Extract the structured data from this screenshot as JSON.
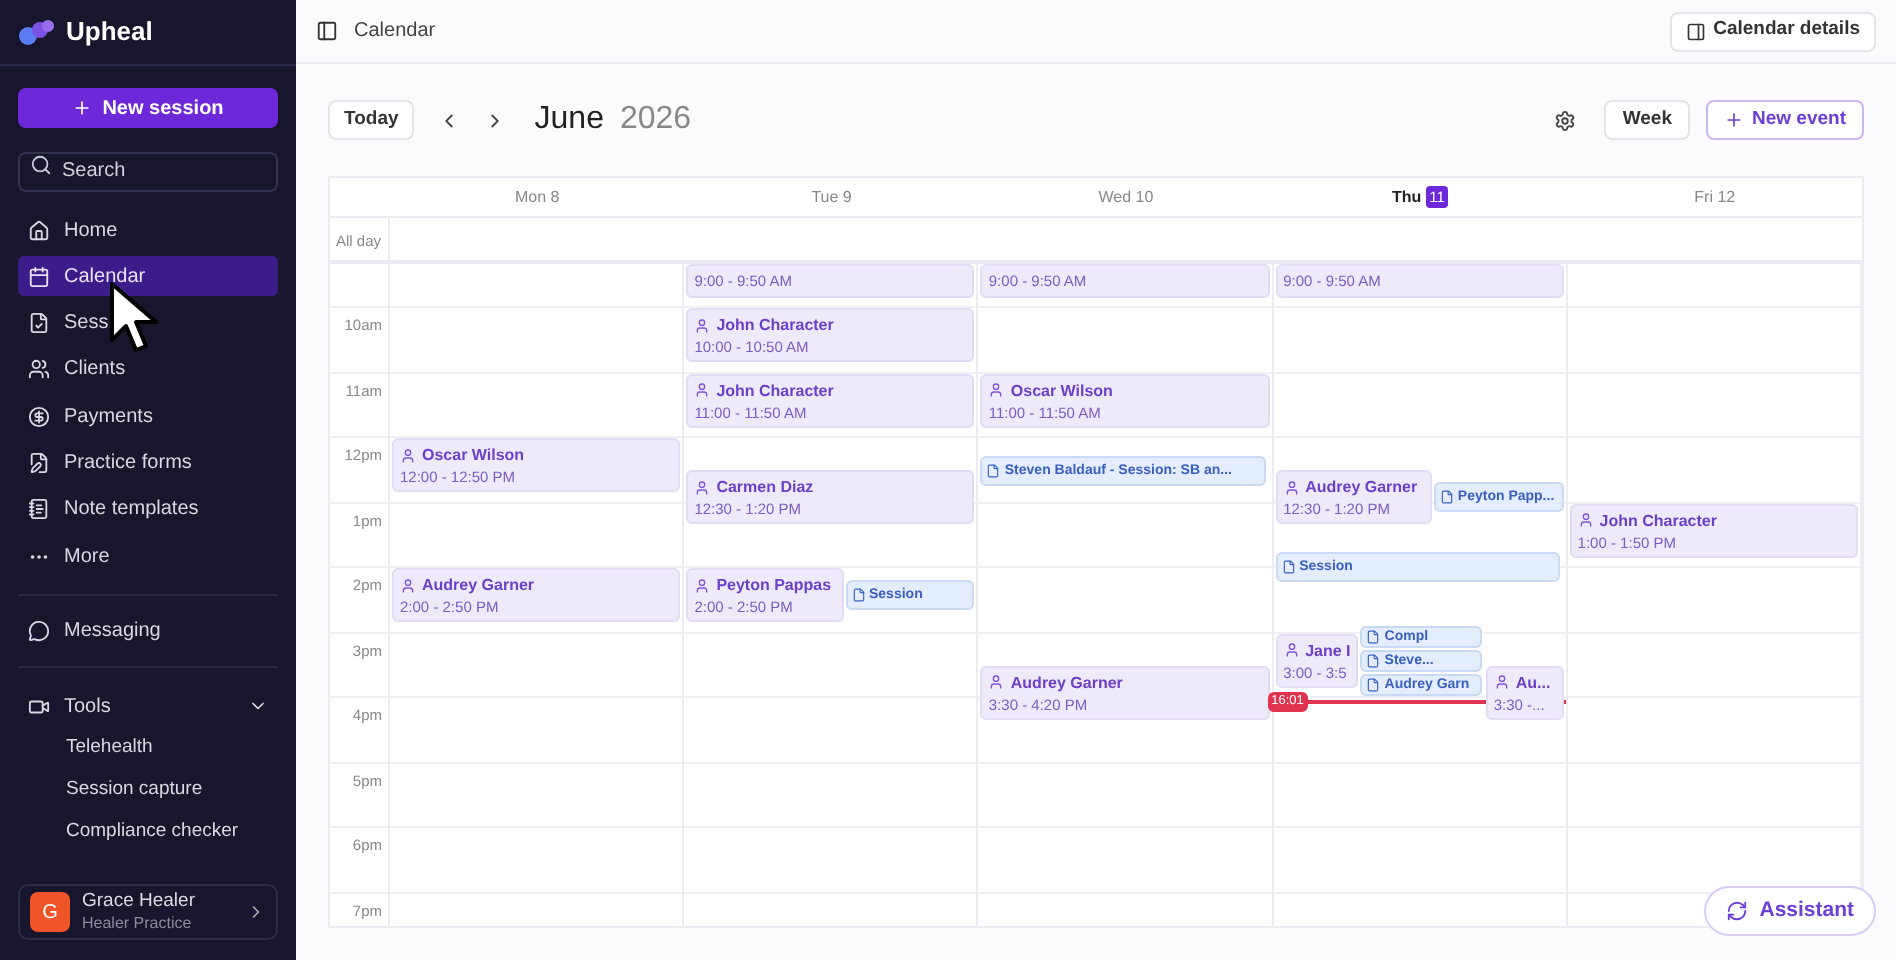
{
  "brand": {
    "name": "Upheal"
  },
  "sidebar": {
    "new_button": "New session",
    "search": {
      "placeholder": "Search"
    },
    "items": [
      {
        "label": "Home",
        "selected": false
      },
      {
        "label": "Calendar",
        "selected": true
      },
      {
        "label": "Sess",
        "selected": false
      },
      {
        "label": "Clients",
        "selected": false
      },
      {
        "label": "Payments",
        "selected": false
      },
      {
        "label": "Practice forms",
        "selected": false
      },
      {
        "label": "Note templates",
        "selected": false
      },
      {
        "label": "More",
        "selected": false
      }
    ],
    "messaging": "Messaging",
    "tools": {
      "label": "Tools",
      "expanded": true,
      "children": [
        "Telehealth",
        "Session capture",
        "Compliance checker"
      ]
    },
    "user": {
      "initial": "G",
      "name": "Grace Healer",
      "practice": "Healer Practice"
    }
  },
  "topbar": {
    "title": "Calendar",
    "details_button": "Calendar details"
  },
  "toolbar": {
    "today": "Today",
    "month": "June",
    "year": "2026",
    "view": "Week",
    "new_event": "New event"
  },
  "calendar": {
    "all_day": "All day",
    "hours": [
      "10am",
      "11am",
      "12pm",
      "1pm",
      "2pm",
      "3pm",
      "4pm",
      "5pm",
      "6pm",
      "7pm"
    ],
    "days": [
      {
        "label": "Mon 8",
        "today": false,
        "events": [
          {
            "kind": "client",
            "name": "Oscar Wilson",
            "time": "12:00 - 12:50 PM"
          },
          {
            "kind": "client",
            "name": "Audrey Garner",
            "time": "2:00 - 2:50 PM"
          }
        ]
      },
      {
        "label": "Tue 9",
        "today": false,
        "events": [
          {
            "kind": "client",
            "time": "9:00 - 9:50 AM"
          },
          {
            "kind": "client",
            "name": "John Character",
            "time": "10:00 - 10:50 AM"
          },
          {
            "kind": "client",
            "name": "John Character",
            "time": "11:00 - 11:50 AM"
          },
          {
            "kind": "client",
            "name": "Carmen Diaz",
            "time": "12:30 - 1:20 PM"
          },
          {
            "kind": "client",
            "name": "Peyton Pappas",
            "time": "2:00 - 2:50 PM",
            "notes": [
              "Session"
            ]
          }
        ]
      },
      {
        "label": "Wed 10",
        "today": false,
        "events": [
          {
            "kind": "client",
            "time": "9:00 - 9:50 AM"
          },
          {
            "kind": "client",
            "name": "Oscar Wilson",
            "time": "11:00 - 11:50 AM"
          },
          {
            "kind": "note",
            "name": "Steven Baldauf - Session: SB an..."
          },
          {
            "kind": "client",
            "name": "Audrey Garner",
            "time": "3:30 - 4:20 PM"
          }
        ]
      },
      {
        "label": "Thu",
        "badge": "11",
        "today": true,
        "now": "16:01",
        "events": [
          {
            "kind": "client",
            "time": "9:00 - 9:50 AM"
          },
          {
            "kind": "client",
            "name": "Audrey Garner",
            "time": "12:30 - 1:20 PM",
            "notes": [
              "Peyton Papp..."
            ]
          },
          {
            "kind": "note",
            "name": "Session"
          },
          {
            "kind": "client",
            "name": "Jane I",
            "time": "3:00 - 3:5",
            "notes": [
              "Compl",
              "Steve...",
              "Audrey Garn"
            ]
          },
          {
            "kind": "client",
            "name": "Au...",
            "time": "3:30 -..."
          }
        ]
      },
      {
        "label": "Fri 12",
        "today": false,
        "events": [
          {
            "kind": "client",
            "name": "John Character",
            "time": "1:00 - 1:50 PM"
          }
        ]
      }
    ]
  },
  "assistant": "Assistant"
}
